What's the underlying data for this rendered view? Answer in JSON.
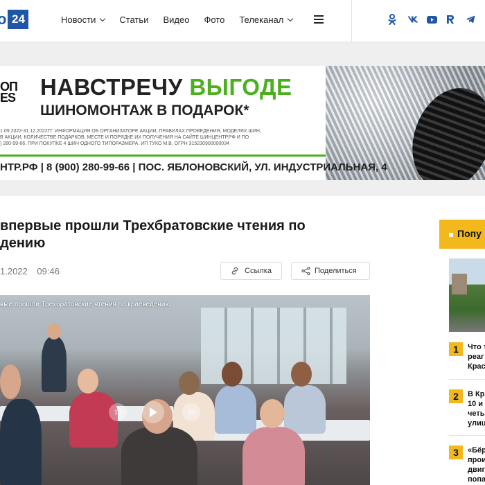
{
  "header": {
    "logo_text": "o",
    "logo_num": "24",
    "nav": [
      {
        "label": "Новости",
        "dropdown": true
      },
      {
        "label": "Статьи",
        "dropdown": false
      },
      {
        "label": "Видео",
        "dropdown": false
      },
      {
        "label": "Фото",
        "dropdown": false
      },
      {
        "label": "Телеканал",
        "dropdown": true
      }
    ],
    "socials": [
      {
        "icon": "odnoklassniki-icon",
        "glyph": "ꝏ"
      },
      {
        "icon": "vk-icon",
        "glyph": "vk"
      },
      {
        "icon": "youtube-icon",
        "glyph": "▶"
      },
      {
        "icon": "rutube-icon",
        "glyph": "R"
      },
      {
        "icon": "telegram-icon",
        "glyph": "➤"
      }
    ],
    "accent": "#1f56a8"
  },
  "banner": {
    "brand": "ОП\nES",
    "title_part1": "НАВСТРЕЧУ ",
    "title_part2": "ВЫГОДЕ",
    "subtitle": "ШИНОМОНТАЖ В ПОДАРОК*",
    "small_print": "1.09.2022-31.12.2022ГГ. ИНФОРМАЦИЯ ОБ ОРГАНИЗАТОРЕ АКЦИИ, ПРАВИЛАХ ПРОВЕДЕНИЯ, МОДЕЛЯХ ШИН,\nВ АКЦИИ, КОЛИЧЕСТВЕ ПОДАРКОВ, МЕСТЕ И ПОРЯДКЕ ИХ ПОЛУЧЕНИЯ НА САЙТЕ ШИНЦЕНТР.РФ И ПО\n) 280-99-66. ПРИ ПОКУПКЕ 4 ШИН ОДНОГО ТИПОРАЗМЕРА. ИП ТУКО М.В. ОГРН 315230900000034",
    "contact": "НТР.РФ  |  8 (900) 280-99-66  |  ПОС. ЯБЛОНОВСКИЙ, УЛ. ИНДУСТРИАЛЬНАЯ, 4",
    "green": "#4caf1e"
  },
  "article": {
    "title": "впервые прошли Трехбратовские чтения по\nдению",
    "date": "1.2022",
    "time": "09:46",
    "link_label": "Ссылка",
    "share_label": "Поделиться",
    "video_title": "вые прошли Трехбратовские чтения по краеведению",
    "rewind_label": "10",
    "forward_label": "10"
  },
  "sidebar": {
    "popular_label": "Попу",
    "items": [
      {
        "num": "1",
        "text": "Что т\nреаг\nКрас"
      },
      {
        "num": "2",
        "text": "В Кр\n10 и\nчеть\nулиц"
      },
      {
        "num": "3",
        "text": "«Бёр\nпрои\nдвиг\nпопа"
      }
    ],
    "accent": "#f3b81b"
  }
}
